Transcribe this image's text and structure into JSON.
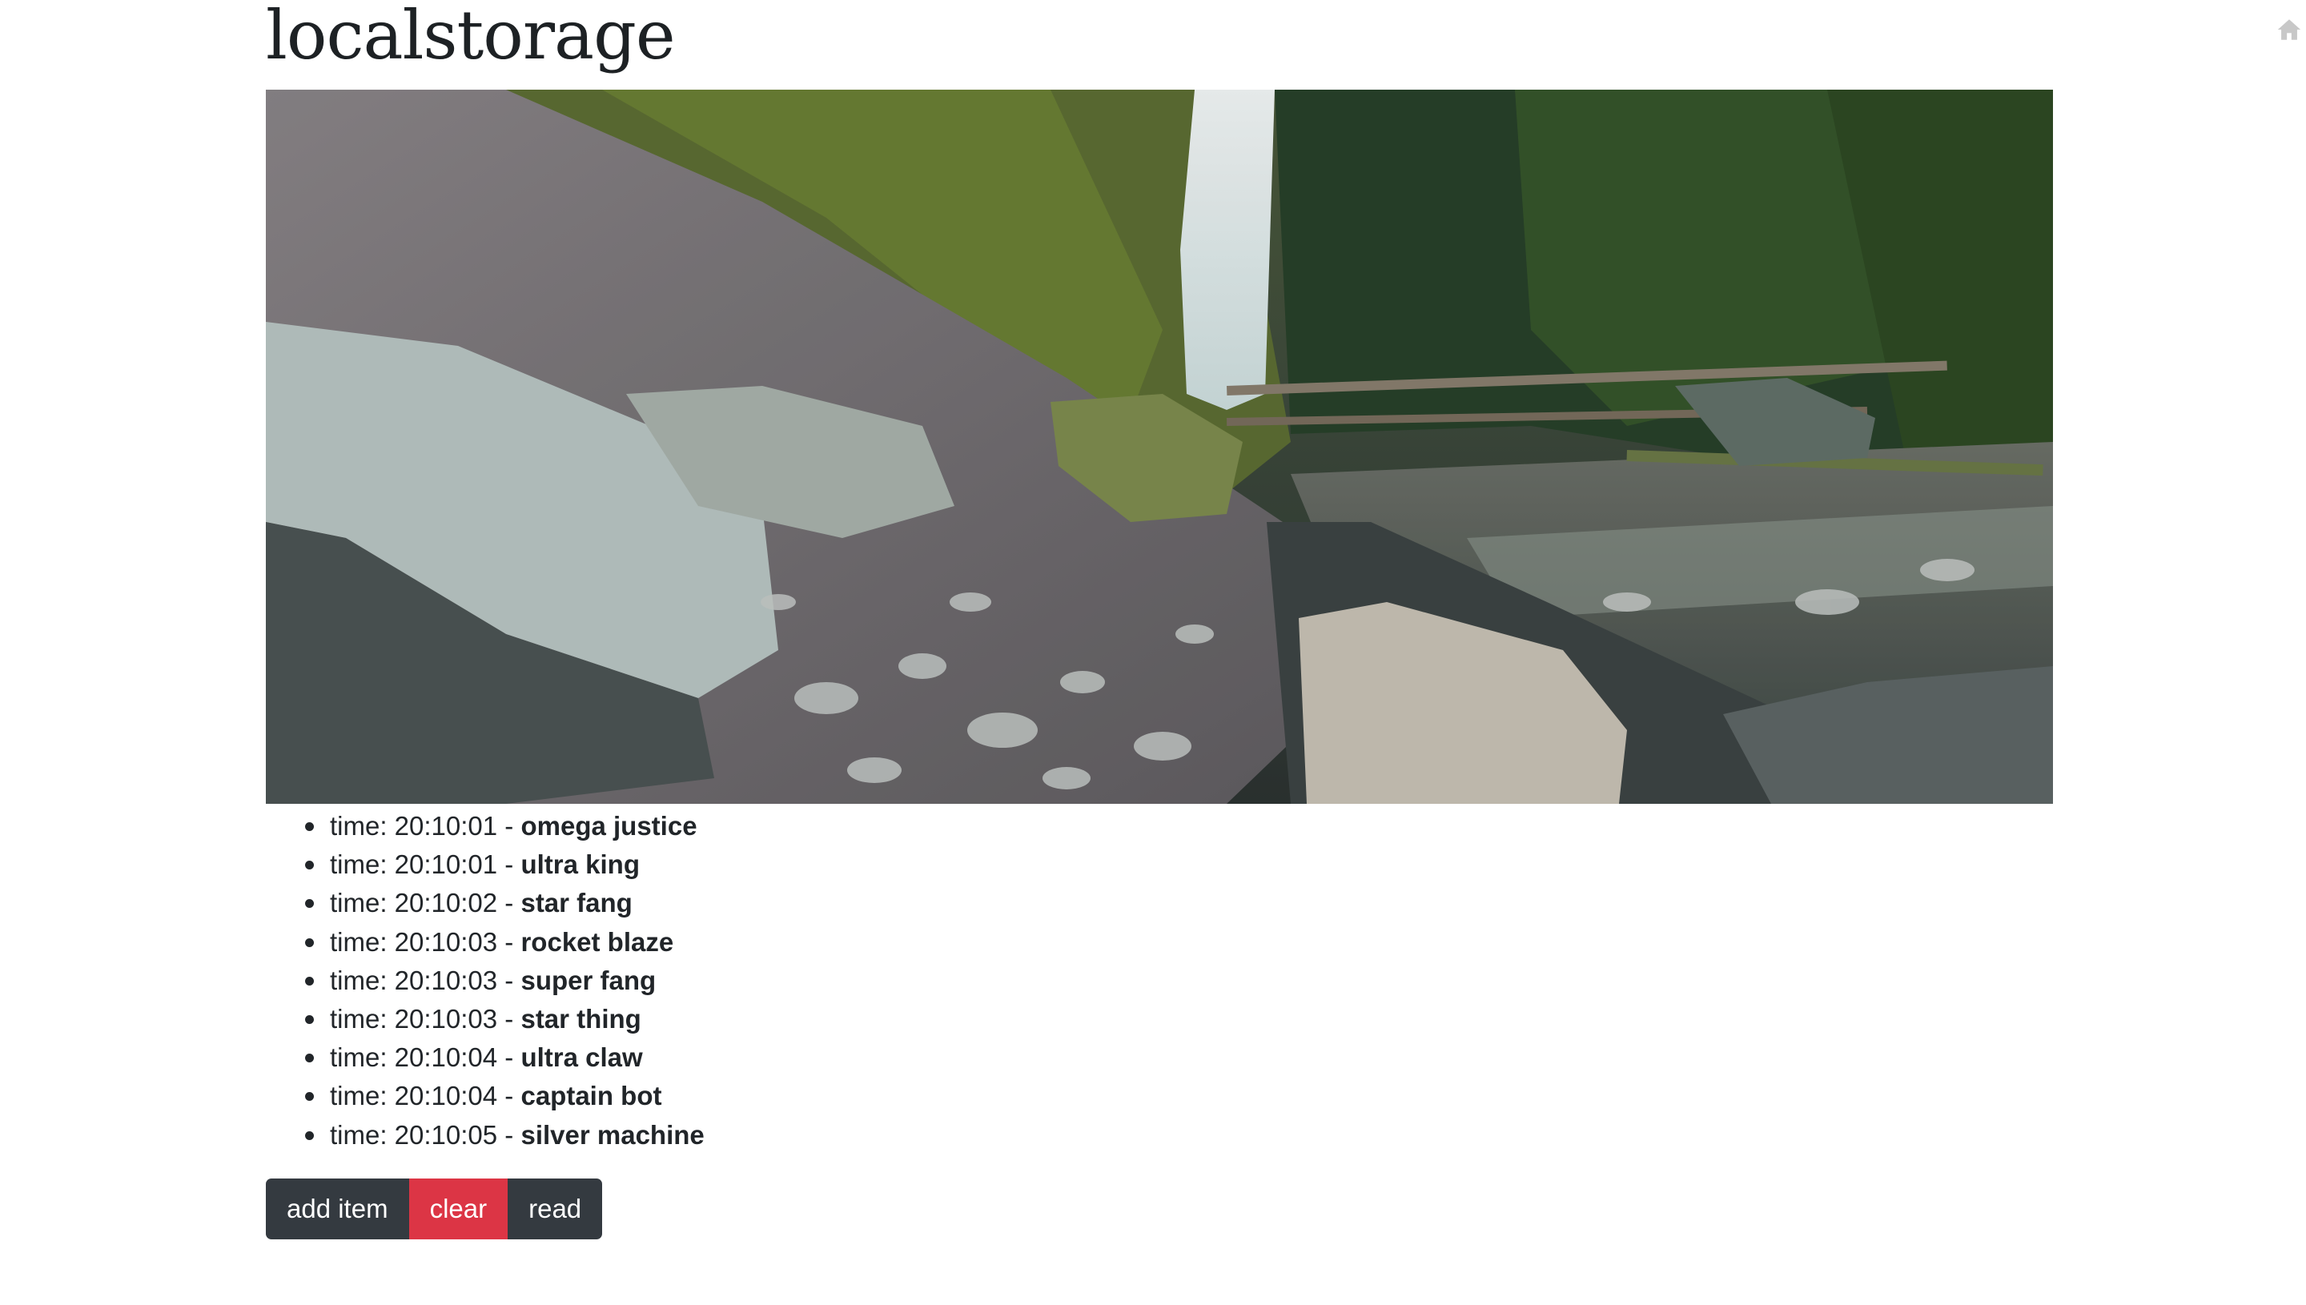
{
  "page": {
    "title": "localstorage"
  },
  "items": [
    {
      "prefix": "time: 20:10:01 - ",
      "name": "omega justice"
    },
    {
      "prefix": "time: 20:10:01 - ",
      "name": "ultra king"
    },
    {
      "prefix": "time: 20:10:02 - ",
      "name": "star fang"
    },
    {
      "prefix": "time: 20:10:03 - ",
      "name": "rocket blaze"
    },
    {
      "prefix": "time: 20:10:03 - ",
      "name": "super fang"
    },
    {
      "prefix": "time: 20:10:03 - ",
      "name": "star thing"
    },
    {
      "prefix": "time: 20:10:04 - ",
      "name": "ultra claw"
    },
    {
      "prefix": "time: 20:10:04 - ",
      "name": "captain bot"
    },
    {
      "prefix": "time: 20:10:05 - ",
      "name": "silver machine"
    }
  ],
  "buttons": {
    "add_label": "add item",
    "clear_label": "clear",
    "read_label": "read"
  },
  "icons": {
    "home": "home-icon"
  },
  "colors": {
    "button_dark": "#343a40",
    "button_danger": "#dc3545",
    "home_icon": "#c8c8c8"
  }
}
